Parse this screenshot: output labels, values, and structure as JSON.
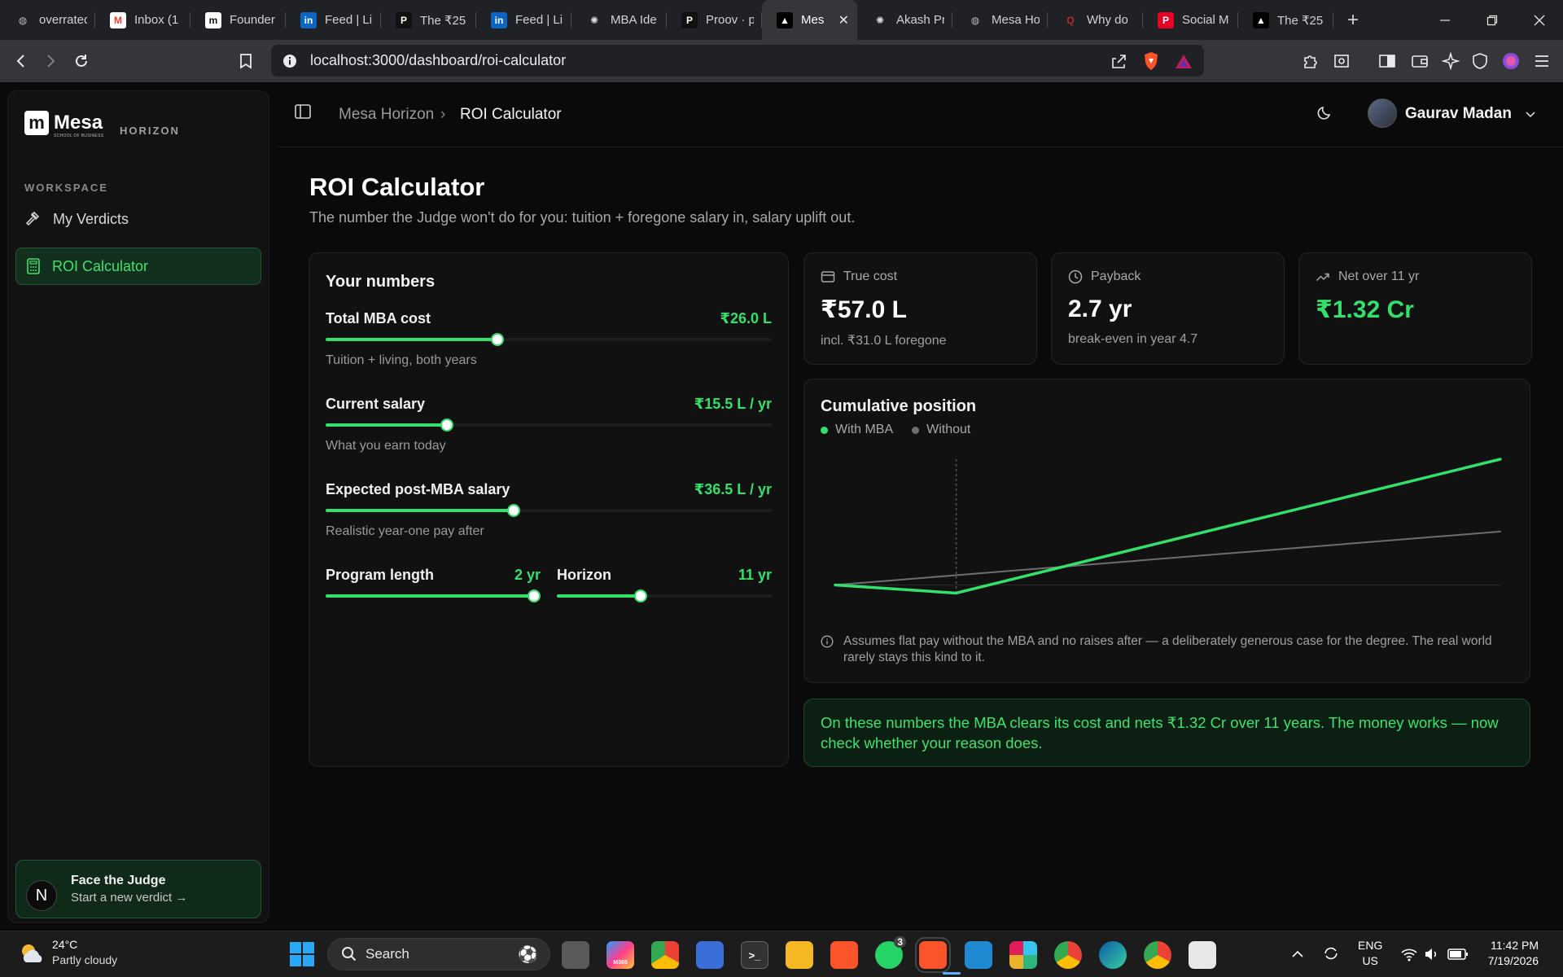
{
  "browser": {
    "tabs": [
      {
        "label": "overrated",
        "icon": "globe-icon"
      },
      {
        "label": "Inbox (1",
        "icon": "gmail-icon"
      },
      {
        "label": "Founder",
        "icon": "mesa-icon"
      },
      {
        "label": "Feed | Li",
        "icon": "linkedin-icon"
      },
      {
        "label": "The ₹25",
        "icon": "p-icon"
      },
      {
        "label": "Feed | Li",
        "icon": "linkedin-icon"
      },
      {
        "label": "MBA Ide",
        "icon": "openai-icon"
      },
      {
        "label": "Proov · p",
        "icon": "p-icon"
      },
      {
        "label": "Mes",
        "icon": "vercel-icon",
        "active": true
      },
      {
        "label": "Akash Pr",
        "icon": "openai-icon"
      },
      {
        "label": "Mesa Ho",
        "icon": "globe-icon"
      },
      {
        "label": "Why do",
        "icon": "quora-icon"
      },
      {
        "label": "Social M",
        "icon": "pinterest-icon"
      },
      {
        "label": "The ₹25",
        "icon": "vercel-icon"
      }
    ],
    "url": "localhost:3000/dashboard/roi-calculator"
  },
  "sidebar": {
    "brand": "Mesa",
    "brand_sub": "SCHOOL OF BUSINESS",
    "brand_tag": "HORIZON",
    "section_label": "WORKSPACE",
    "items": [
      {
        "label": "My Verdicts",
        "icon": "gavel-icon",
        "active": false
      },
      {
        "label": "ROI Calculator",
        "icon": "calculator-icon",
        "active": true
      }
    ],
    "cta": {
      "title": "Face the Judge",
      "subtitle": "Start a new verdict →",
      "badge": "N"
    }
  },
  "header": {
    "breadcrumb": [
      "Mesa Horizon",
      "ROI Calculator"
    ],
    "user_name": "Gaurav Madan"
  },
  "page": {
    "title": "ROI Calculator",
    "subtitle": "The number the Judge won't do for you: tuition + foregone salary in, salary uplift out."
  },
  "inputs": {
    "title": "Your numbers",
    "fields": [
      {
        "label": "Total MBA cost",
        "value": "₹26.0 L",
        "help": "Tuition + living, both years",
        "fraction": 0.385
      },
      {
        "label": "Current salary",
        "value": "₹15.5 L / yr",
        "help": "What you earn today",
        "fraction": 0.272
      },
      {
        "label": "Expected post-MBA salary",
        "value": "₹36.5 L / yr",
        "help": "Realistic year-one pay after",
        "fraction": 0.421
      }
    ],
    "program_length": {
      "label": "Program length",
      "value": "2 yr",
      "fraction": 0.97
    },
    "horizon": {
      "label": "Horizon",
      "value": "11 yr",
      "fraction": 0.39
    }
  },
  "stats": {
    "true_cost": {
      "label": "True cost",
      "value": "₹57.0 L",
      "sub": "incl. ₹31.0 L foregone"
    },
    "payback": {
      "label": "Payback",
      "value": "2.7 yr",
      "sub": "break-even in year 4.7"
    },
    "net": {
      "label": "Net over 11 yr",
      "value": "₹1.32 Cr"
    }
  },
  "chart": {
    "title": "Cumulative position",
    "legend": [
      "With MBA",
      "Without"
    ],
    "note": "Assumes flat pay without the MBA and no raises after — a deliberately generous case for the degree. The real world rarely stays this kind to it.",
    "colors": {
      "with": "#33e06b",
      "without": "#6e6e6e"
    }
  },
  "chart_data": {
    "type": "line",
    "x": [
      0,
      2,
      11
    ],
    "series": [
      {
        "name": "With MBA",
        "values": [
          0,
          -26,
          401.5
        ]
      },
      {
        "name": "Without",
        "values": [
          0,
          31,
          170.5
        ]
      }
    ],
    "xlim": [
      0,
      11
    ],
    "ylim": [
      -30,
      401.5
    ],
    "marker_x": 2,
    "grid": false,
    "legend": "top-left"
  },
  "verdict": {
    "text": "On these numbers the MBA clears its cost and nets ₹1.32 Cr over 11 years. The money works — now check whether your reason does."
  },
  "taskbar": {
    "weather_temp": "24°C",
    "weather_desc": "Partly cloudy",
    "search_label": "Search",
    "whatsapp_badge": "3",
    "m365_label": "M365",
    "lang_top": "ENG",
    "lang_bottom": "US",
    "time": "11:42 PM",
    "date": "7/19/2026"
  }
}
